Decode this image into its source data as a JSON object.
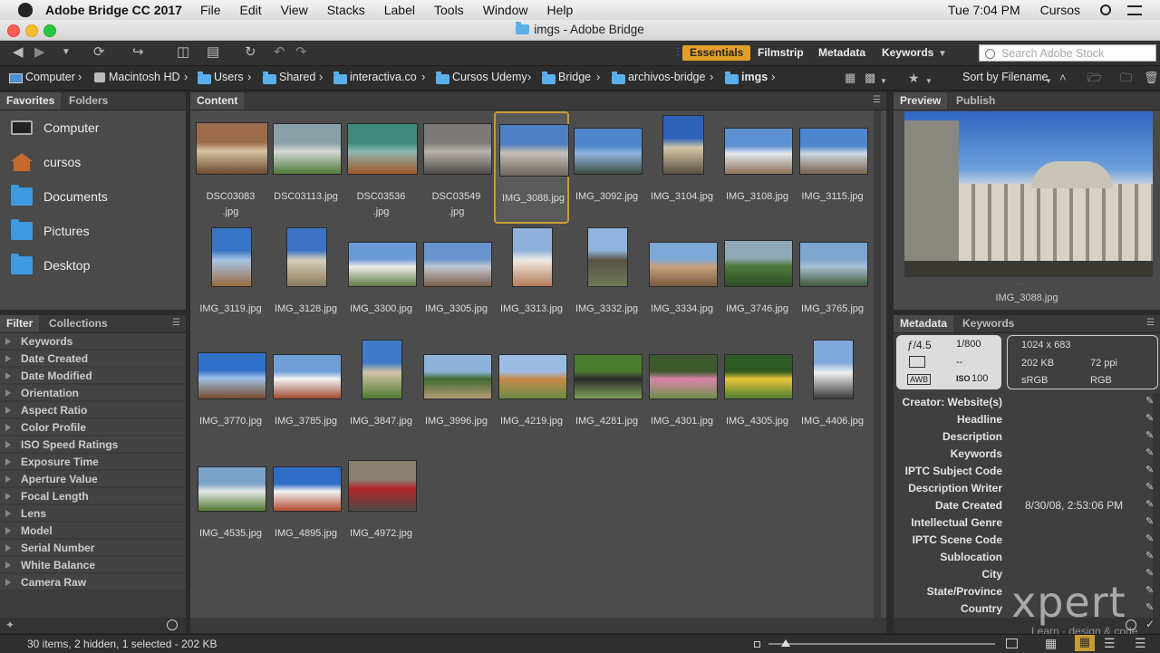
{
  "menubar": {
    "app_name": "Adobe Bridge CC 2017",
    "menus": [
      "File",
      "Edit",
      "View",
      "Stacks",
      "Label",
      "Tools",
      "Window",
      "Help"
    ],
    "clock": "Tue 7:04 PM",
    "user": "Cursos"
  },
  "window": {
    "title": "imgs - Adobe Bridge"
  },
  "toolbar": {
    "workspaces": [
      "Essentials",
      "Filmstrip",
      "Metadata",
      "Keywords"
    ],
    "active_workspace": "Essentials",
    "search_placeholder": "Search Adobe Stock"
  },
  "path_bar": {
    "crumbs": [
      "Computer",
      "Macintosh HD",
      "Users",
      "Shared",
      "interactiva.co",
      "Cursos Udemy",
      "Bridge",
      "archivos-bridge",
      "imgs"
    ],
    "sort_label": "Sort by Filename"
  },
  "favorites_panel": {
    "tabs": [
      "Favorites",
      "Folders"
    ],
    "items": [
      "Computer",
      "cursos",
      "Documents",
      "Pictures",
      "Desktop"
    ]
  },
  "filter_panel": {
    "tabs": [
      "Filter",
      "Collections"
    ],
    "items": [
      "Keywords",
      "Date Created",
      "Date Modified",
      "Orientation",
      "Aspect Ratio",
      "Color Profile",
      "ISO Speed Ratings",
      "Exposure Time",
      "Aperture Value",
      "Focal Length",
      "Lens",
      "Model",
      "Serial Number",
      "White Balance",
      "Camera Raw"
    ]
  },
  "content_panel": {
    "tab": "Content",
    "selected": "IMG_3088.jpg",
    "files": [
      {
        "name": "DSC03083\n.jpg",
        "colors": [
          "#9b6b4b",
          "#d8c2a2",
          "#6b4a2d"
        ]
      },
      {
        "name": "DSC03113.jpg",
        "colors": [
          "#8aa0a8",
          "#d5d7d2",
          "#4f7a3a"
        ]
      },
      {
        "name": "DSC03536\n.jpg",
        "colors": [
          "#3f8a7a",
          "#8cb8b0",
          "#a0552a"
        ]
      },
      {
        "name": "DSC03549\n.jpg",
        "colors": [
          "#7d7a78",
          "#b9b3ab",
          "#4d4a48"
        ]
      },
      {
        "name": "IMG_3088.jpg",
        "colors": [
          "#4f7fc0",
          "#c8c0b8",
          "#6a665f"
        ]
      },
      {
        "name": "IMG_3092.jpg",
        "colors": [
          "#4f86c9",
          "#8fb4de",
          "#3d4c3e"
        ]
      },
      {
        "name": "IMG_3104.jpg",
        "colors": [
          "#2d62b8",
          "#d6c6a6",
          "#5a4f40"
        ]
      },
      {
        "name": "IMG_3108.jpg",
        "colors": [
          "#5d90d0",
          "#e4e9f0",
          "#8b7055"
        ]
      },
      {
        "name": "IMG_3115.jpg",
        "colors": [
          "#4d86cf",
          "#cdd6e0",
          "#77624b"
        ]
      },
      {
        "name": "IMG_3119.jpg",
        "colors": [
          "#3874c6",
          "#a8c6e6",
          "#9a6b3e"
        ]
      },
      {
        "name": "IMG_3128.jpg",
        "colors": [
          "#3b72c4",
          "#d8cdb8",
          "#8a7a5d"
        ]
      },
      {
        "name": "IMG_3300.jpg",
        "colors": [
          "#6b9bd6",
          "#f0eee8",
          "#5d7a44"
        ]
      },
      {
        "name": "IMG_3305.jpg",
        "colors": [
          "#6a95cc",
          "#c0c7cf",
          "#7e5f4a"
        ]
      },
      {
        "name": "IMG_3313.jpg",
        "colors": [
          "#8fb2dc",
          "#eeeae2",
          "#b57a5a"
        ]
      },
      {
        "name": "IMG_3332.jpg",
        "colors": [
          "#8fb4dd",
          "#5a5347",
          "#6b7a55"
        ]
      },
      {
        "name": "IMG_3334.jpg",
        "colors": [
          "#7da8d8",
          "#c9a07a",
          "#7a5a40"
        ]
      },
      {
        "name": "IMG_3746.jpg",
        "colors": [
          "#8fa9b8",
          "#4e7a3a",
          "#2f4b25"
        ]
      },
      {
        "name": "IMG_3765.jpg",
        "colors": [
          "#7ea6cf",
          "#a7bfd3",
          "#405836"
        ]
      },
      {
        "name": "IMG_3770.jpg",
        "colors": [
          "#2f70c8",
          "#9ec0e6",
          "#7a4b30"
        ]
      },
      {
        "name": "IMG_3785.jpg",
        "colors": [
          "#6f9fd6",
          "#f2f2f2",
          "#a04a35"
        ]
      },
      {
        "name": "IMG_3847.jpg",
        "colors": [
          "#3e7ac8",
          "#d4c3a5",
          "#4e7b32"
        ]
      },
      {
        "name": "IMG_3996.jpg",
        "colors": [
          "#8eb3da",
          "#3f6a2f",
          "#b59a78"
        ]
      },
      {
        "name": "IMG_4219.jpg",
        "colors": [
          "#9cbde2",
          "#c68a4a",
          "#6d8c45"
        ]
      },
      {
        "name": "IMG_4281.jpg",
        "colors": [
          "#4a7a2e",
          "#2b2b2b",
          "#7fa25a"
        ]
      },
      {
        "name": "IMG_4301.jpg",
        "colors": [
          "#3c5a2e",
          "#d983a8",
          "#6d8f4a"
        ]
      },
      {
        "name": "IMG_4305.jpg",
        "colors": [
          "#2e5a23",
          "#e8c53a",
          "#4e7c34"
        ]
      },
      {
        "name": "IMG_4406.jpg",
        "colors": [
          "#7fa9dc",
          "#f0f0f0",
          "#3a3a3a"
        ]
      },
      {
        "name": "IMG_4535.jpg",
        "colors": [
          "#7aa2c8",
          "#e8e8e8",
          "#4e7a30"
        ]
      },
      {
        "name": "IMG_4895.jpg",
        "colors": [
          "#2f6cc6",
          "#f3f3f3",
          "#b24a2f"
        ]
      },
      {
        "name": "IMG_4972.jpg",
        "colors": [
          "#8a7f70",
          "#b5232b",
          "#4c4a45"
        ]
      }
    ]
  },
  "preview_panel": {
    "tabs": [
      "Preview",
      "Publish"
    ],
    "caption": "IMG_3088.jpg"
  },
  "metadata_panel": {
    "tabs": [
      "Metadata",
      "Keywords"
    ],
    "aperture": "ƒ/4.5",
    "shutter": "1/800",
    "metering": "--",
    "iso": "100",
    "wb": "AWB",
    "dimensions": "1024 x 683",
    "filesize": "202 KB",
    "resolution": "72 ppi",
    "colorprofile": "sRGB",
    "colormode": "RGB",
    "fields": [
      {
        "k": "Creator: Website(s)",
        "v": ""
      },
      {
        "k": "Headline",
        "v": ""
      },
      {
        "k": "Description",
        "v": ""
      },
      {
        "k": "Keywords",
        "v": ""
      },
      {
        "k": "IPTC Subject Code",
        "v": ""
      },
      {
        "k": "Description Writer",
        "v": ""
      },
      {
        "k": "Date Created",
        "v": "8/30/08, 2:53:06 PM"
      },
      {
        "k": "Intellectual Genre",
        "v": ""
      },
      {
        "k": "IPTC Scene Code",
        "v": ""
      },
      {
        "k": "Sublocation",
        "v": ""
      },
      {
        "k": "City",
        "v": ""
      },
      {
        "k": "State/Province",
        "v": ""
      },
      {
        "k": "Country",
        "v": ""
      }
    ]
  },
  "status": {
    "text": "30 items, 2 hidden, 1 selected - 202 KB"
  },
  "watermark": {
    "text": "xpert",
    "sub": "Learn · design & code"
  },
  "colors": {
    "accent": "#e0a027",
    "selection_border": "#c89a30",
    "panel_bg": "#4a4a4a"
  }
}
